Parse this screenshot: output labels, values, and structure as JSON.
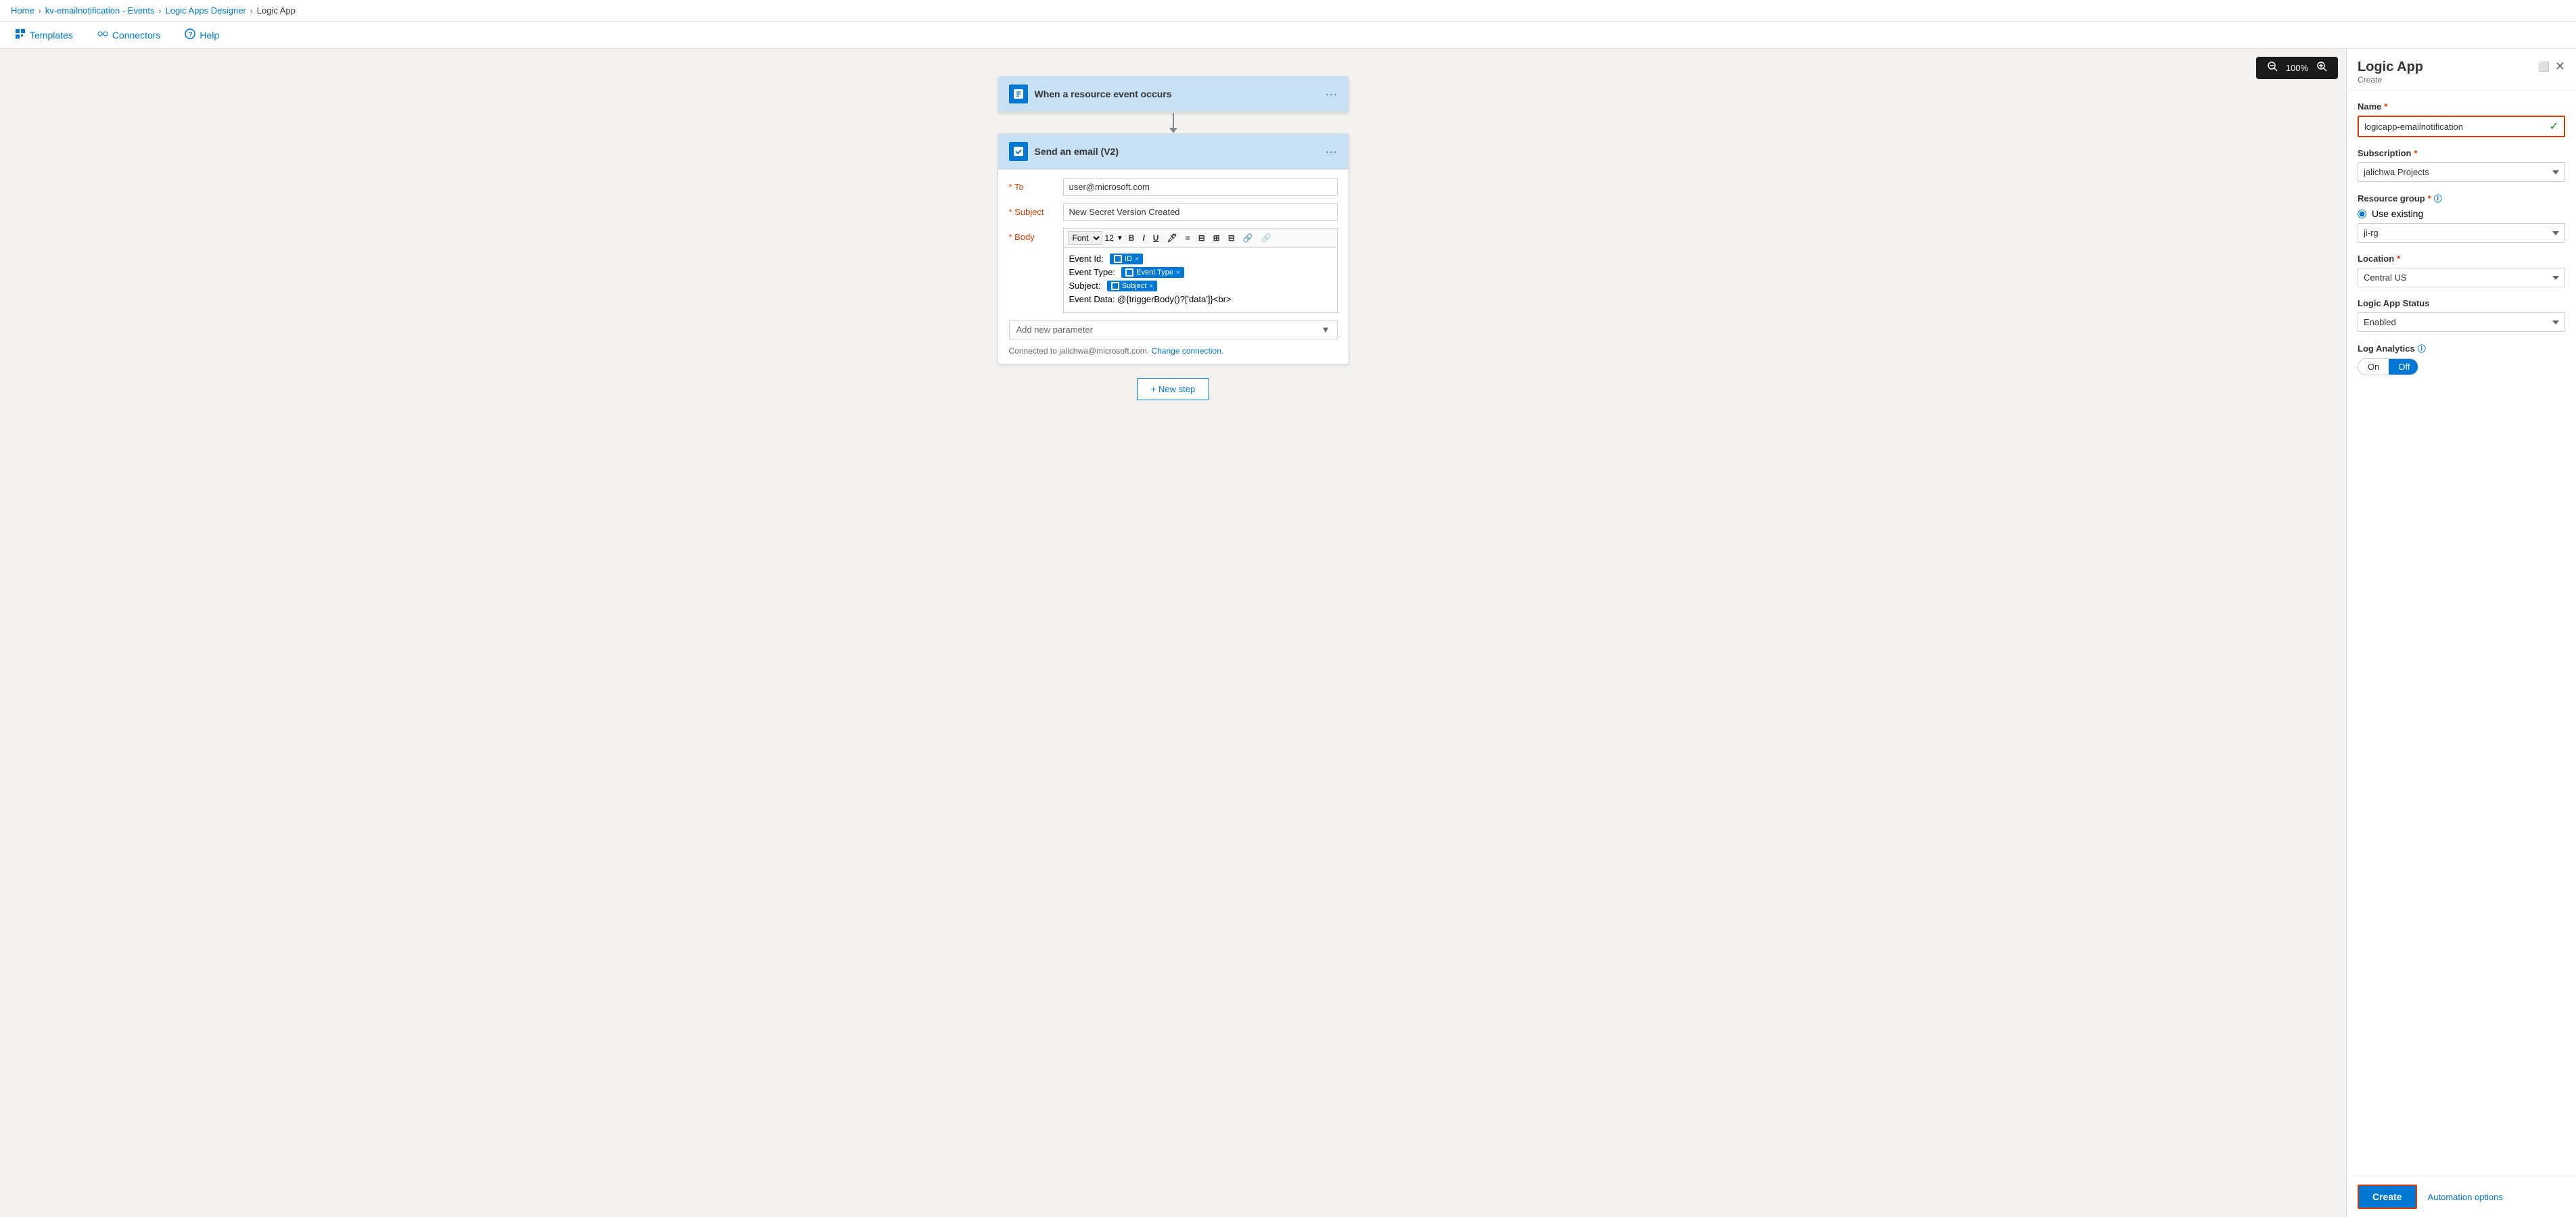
{
  "breadcrumb": {
    "items": [
      "Home",
      "kv-emailnotification - Events",
      "Logic Apps Designer",
      "Logic App"
    ]
  },
  "toolbar": {
    "templates_label": "Templates",
    "connectors_label": "Connectors",
    "help_label": "Help"
  },
  "zoom": {
    "level": "100%"
  },
  "workflow": {
    "trigger": {
      "title": "When a resource event occurs"
    },
    "action": {
      "title": "Send an email (V2)",
      "to_label": "To",
      "to_value": "user@microsoft.com",
      "subject_label": "Subject",
      "subject_value": "New Secret Version Created",
      "body_label": "Body",
      "font_label": "Font",
      "font_size": "12",
      "body_lines": [
        "Event Id:",
        "Event Type:",
        "Subject:",
        "Event Data: @{triggerBody()?['data']}<br>"
      ],
      "tags": {
        "id": "ID",
        "event_type": "Event Type",
        "subject": "Subject"
      },
      "add_param_label": "Add new parameter",
      "connected_text": "Connected to jalichwa@microsoft.com.",
      "change_connection_label": "Change connection."
    },
    "new_step_label": "+ New step"
  },
  "panel": {
    "title": "Logic App",
    "subtitle": "Create",
    "name_label": "Name",
    "name_value": "logicapp-emailnotification",
    "subscription_label": "Subscription",
    "subscription_value": "jalichwa Projects",
    "resource_group_label": "Resource group",
    "use_existing_label": "Use existing",
    "rg_value": "ji-rg",
    "location_label": "Location",
    "location_value": "Central US",
    "status_label": "Logic App Status",
    "status_value": "Enabled",
    "log_analytics_label": "Log Analytics",
    "log_on_label": "On",
    "log_off_label": "Off",
    "create_button_label": "Create",
    "automation_options_label": "Automation options"
  }
}
